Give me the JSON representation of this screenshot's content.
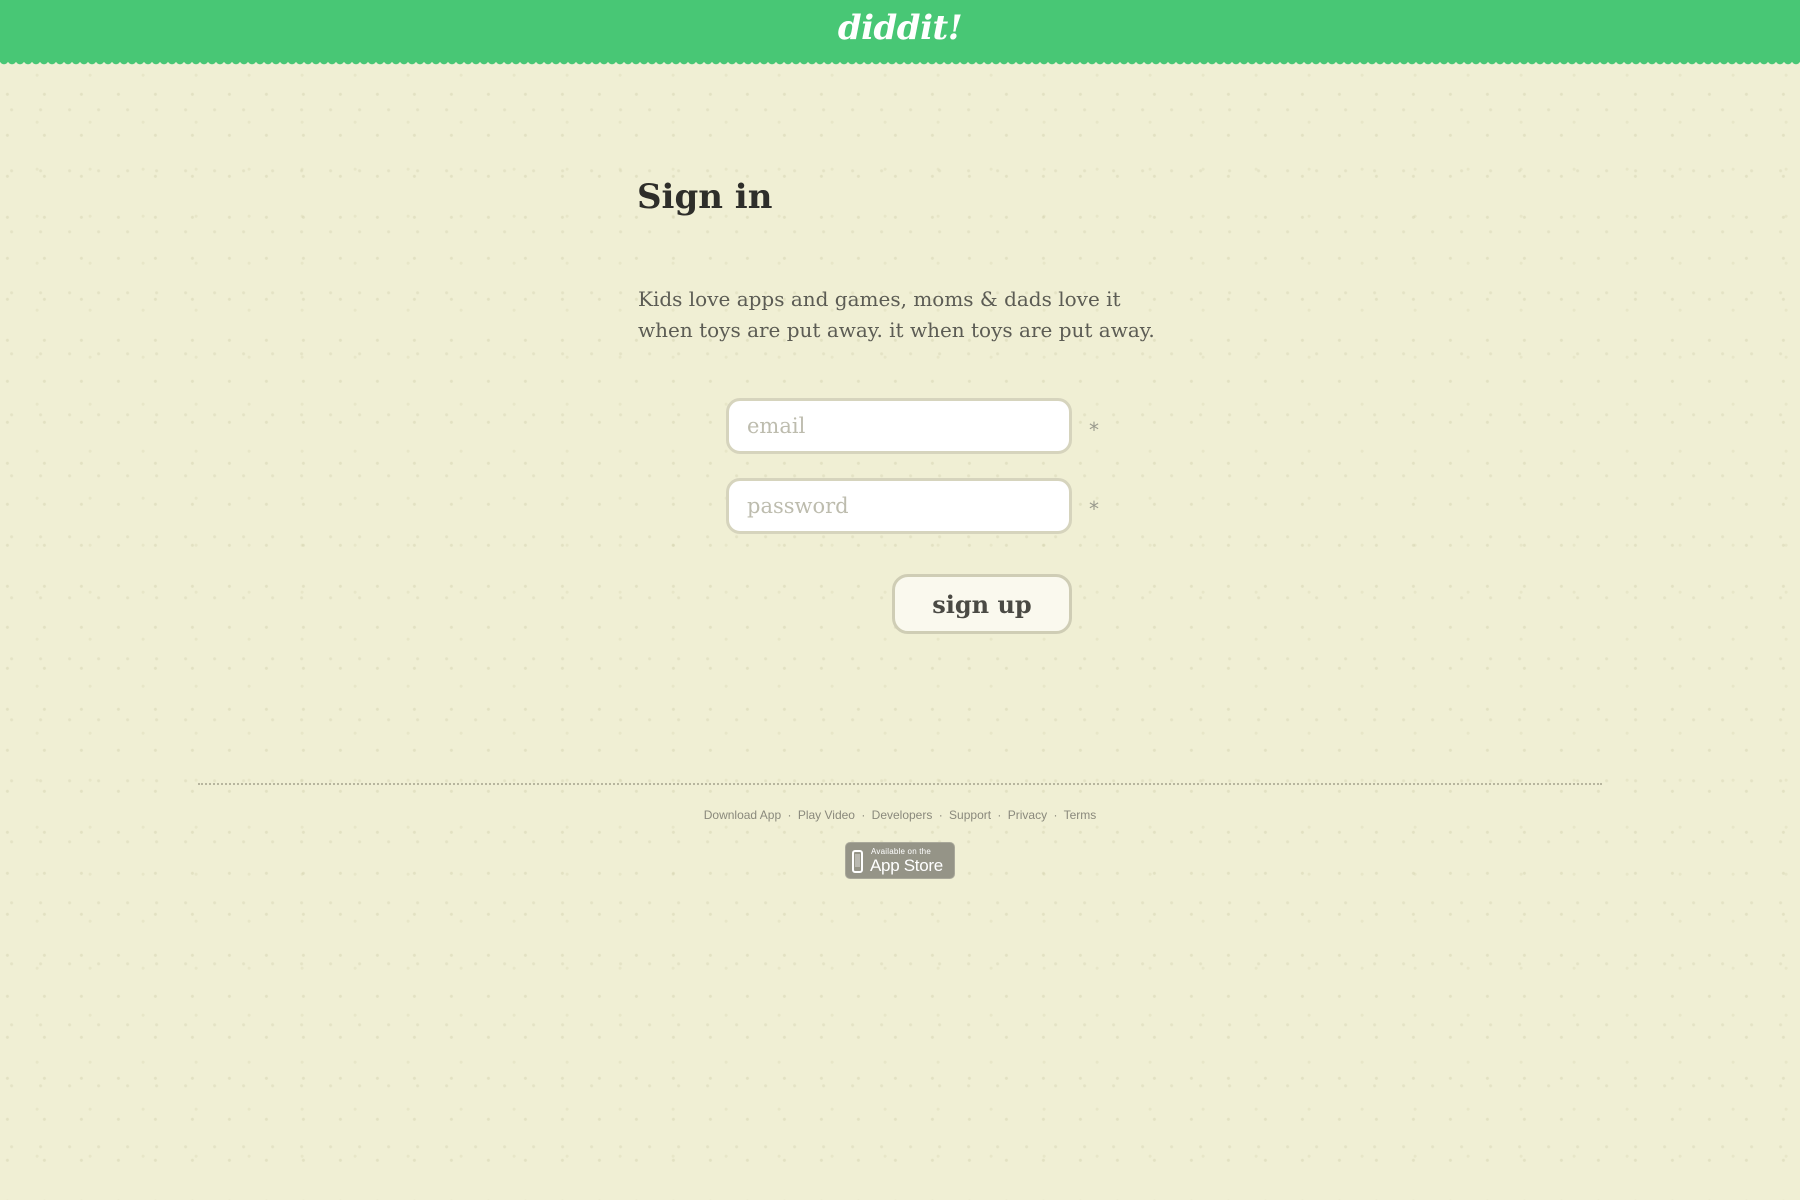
{
  "header": {
    "logo": "diddit!"
  },
  "signin": {
    "title": "Sign in",
    "intro": "Kids love apps and games, moms & dads love it when toys are put away. it when toys are put away.",
    "email_placeholder": "email",
    "password_placeholder": "password",
    "required_marker": "*",
    "submit_label": "sign up"
  },
  "footer": {
    "links": [
      "Download App",
      "Play Video",
      "Developers",
      "Support",
      "Privacy",
      "Terms"
    ],
    "separator": "·",
    "badge": {
      "small_text": "Available on the",
      "large_text": "App Store"
    }
  },
  "colors": {
    "header_green": "#48c775",
    "page_background": "#f0efd4",
    "field_border": "#d6d4bd"
  },
  "icons": {
    "badge_icon": "iphone-icon"
  }
}
